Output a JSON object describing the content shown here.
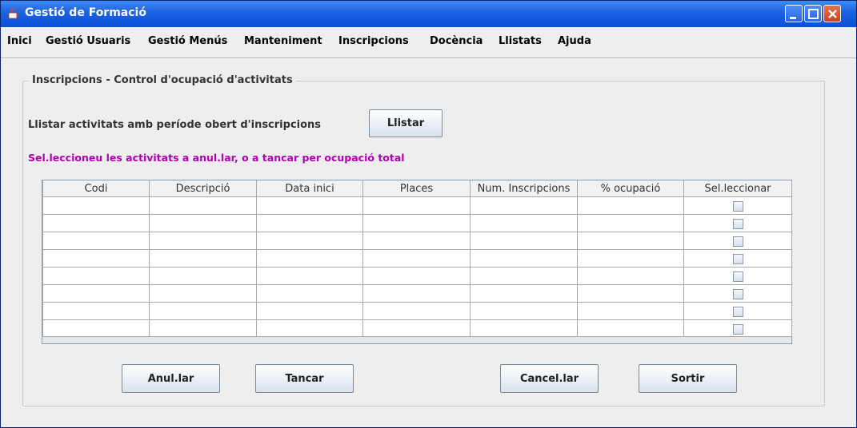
{
  "window": {
    "title": "Gestió de Formació",
    "buttons": [
      "minimize-icon",
      "maximize-icon",
      "close-icon"
    ]
  },
  "menu": {
    "items": [
      {
        "label": "Inici"
      },
      {
        "label": "Gestió Usuaris"
      },
      {
        "label": "Gestió Menús"
      },
      {
        "label": "Manteniment"
      },
      {
        "label": "Inscripcions"
      },
      {
        "label": "Docència"
      },
      {
        "label": "Llistats"
      },
      {
        "label": "Ajuda"
      }
    ]
  },
  "panel": {
    "title": "Inscripcions - Control d'ocupació d'activitats",
    "list_label": "Llistar activitats amb període obert d'inscripcions",
    "list_button": "Llistar",
    "hint": "Sel.leccioneu les activitats a anul.lar, o a tancar per ocupació total",
    "hint_color": "#b000b0"
  },
  "table": {
    "columns": [
      "Codi",
      "Descripció",
      "Data inici",
      "Places",
      "Num. Inscripcions",
      "% ocupació",
      "Sel.leccionar"
    ],
    "rows": [
      [
        "",
        "",
        "",
        "",
        "",
        "",
        false
      ],
      [
        "",
        "",
        "",
        "",
        "",
        "",
        false
      ],
      [
        "",
        "",
        "",
        "",
        "",
        "",
        false
      ],
      [
        "",
        "",
        "",
        "",
        "",
        "",
        false
      ],
      [
        "",
        "",
        "",
        "",
        "",
        "",
        false
      ],
      [
        "",
        "",
        "",
        "",
        "",
        "",
        false
      ],
      [
        "",
        "",
        "",
        "",
        "",
        "",
        false
      ],
      [
        "",
        "",
        "",
        "",
        "",
        "",
        false
      ]
    ]
  },
  "actions": {
    "anular": "Anul.lar",
    "tancar": "Tancar",
    "cancelar": "Cancel.lar",
    "sortir": "Sortir"
  },
  "colors": {
    "titlebar": "#0a4fd6",
    "window_bg": "#eeeeee",
    "hint": "#b000b0"
  }
}
